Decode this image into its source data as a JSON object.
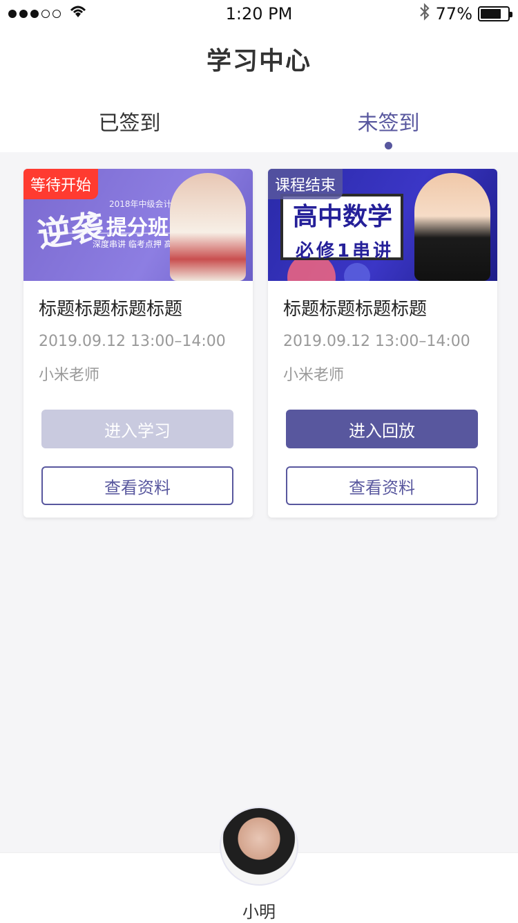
{
  "status_bar": {
    "signal": "●●●○○",
    "time": "1:20 PM",
    "bluetooth": "bluetooth-icon",
    "battery": "77%",
    "battery_fill": 0.77
  },
  "header": {
    "title": "学习中心"
  },
  "tabs": [
    {
      "label": "已签到",
      "active": false
    },
    {
      "label": "未签到",
      "active": true
    }
  ],
  "cards": [
    {
      "banner": {
        "tag": "等待开始",
        "subtitle": "2018年中级会计职称",
        "main_text": "提分班",
        "calligraphy": "逆袭",
        "small_text": "深度串讲  临考点押  高效提分"
      },
      "title": "标题标题标题标题",
      "time": "2019.09.12 13:00–14:00",
      "teacher": "小米老师",
      "primary_button": {
        "label": "进入学习",
        "disabled": true
      },
      "outline_button": {
        "label": "查看资料"
      }
    },
    {
      "banner": {
        "tag": "课程结束",
        "board_title": "高中数学",
        "board_sub": "必修1串讲"
      },
      "title": "标题标题标题标题",
      "time": "2019.09.12 13:00–14:00",
      "teacher": "小米老师",
      "primary_button": {
        "label": "进入回放",
        "disabled": false
      },
      "outline_button": {
        "label": "查看资料"
      }
    }
  ],
  "bottom": {
    "avatar_name": "小明"
  },
  "colors": {
    "accent": "#58579e",
    "tag_red": "#ff3b30",
    "disabled": "#c9cadf"
  }
}
